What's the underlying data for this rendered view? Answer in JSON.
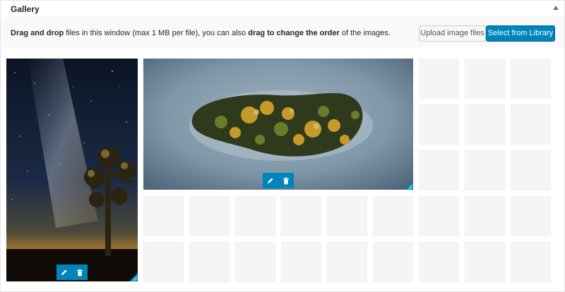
{
  "panel": {
    "title": "Gallery"
  },
  "toolbar": {
    "instructions": {
      "part1": "Drag and drop",
      "part2": " files in this window (max 1 MB per file), you can also ",
      "part3": "drag to change the order",
      "part4": " of the images."
    },
    "upload_label": "Upload image files",
    "library_label": "Select from Library"
  },
  "gallery": {
    "images": [
      {
        "alt": "Night sky with Milky Way over a Joshua tree",
        "actions": [
          "edit",
          "delete"
        ]
      },
      {
        "alt": "Aerial view of an autumn island surrounded by fog",
        "actions": [
          "edit",
          "delete"
        ]
      }
    ],
    "icons": {
      "edit": "pencil-icon",
      "delete": "trash-icon",
      "collapse": "triangle-up-icon",
      "resize": "resize-handle-icon"
    }
  },
  "colors": {
    "accent": "#0085ba",
    "placeholder": "#f5f5f5"
  }
}
